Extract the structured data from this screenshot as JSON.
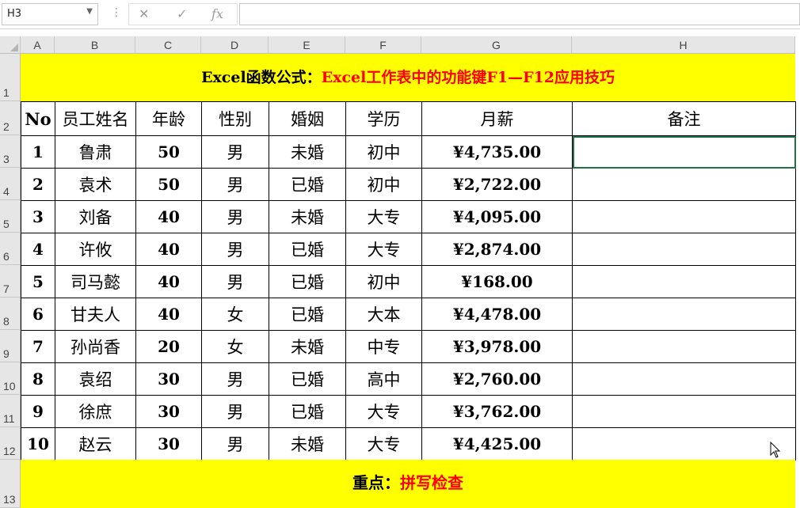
{
  "namebox": {
    "value": "H3"
  },
  "formula_bar": {
    "content": ""
  },
  "columns": [
    "A",
    "B",
    "C",
    "D",
    "E",
    "F",
    "G",
    "H"
  ],
  "rows": [
    "1",
    "2",
    "3",
    "4",
    "5",
    "6",
    "7",
    "8",
    "9",
    "10",
    "11",
    "12",
    "13"
  ],
  "title": {
    "prefix": "Excel函数公式：",
    "main": "Excel工作表中的功能键F1—F12应用技巧"
  },
  "table": {
    "headers": [
      "No",
      "员工姓名",
      "年龄",
      "性别",
      "婚姻",
      "学历",
      "月薪",
      "备注"
    ],
    "rows": [
      [
        "1",
        "鲁肃",
        "50",
        "男",
        "未婚",
        "初中",
        "¥4,735.00",
        ""
      ],
      [
        "2",
        "袁术",
        "50",
        "男",
        "已婚",
        "初中",
        "¥2,722.00",
        ""
      ],
      [
        "3",
        "刘备",
        "40",
        "男",
        "未婚",
        "大专",
        "¥4,095.00",
        ""
      ],
      [
        "4",
        "许攸",
        "40",
        "男",
        "已婚",
        "大专",
        "¥2,874.00",
        ""
      ],
      [
        "5",
        "司马懿",
        "40",
        "男",
        "已婚",
        "初中",
        "¥168.00",
        ""
      ],
      [
        "6",
        "甘夫人",
        "40",
        "女",
        "已婚",
        "大本",
        "¥4,478.00",
        ""
      ],
      [
        "7",
        "孙尚香",
        "20",
        "女",
        "未婚",
        "中专",
        "¥3,978.00",
        ""
      ],
      [
        "8",
        "袁绍",
        "30",
        "男",
        "已婚",
        "高中",
        "¥2,760.00",
        ""
      ],
      [
        "9",
        "徐庶",
        "30",
        "男",
        "已婚",
        "大专",
        "¥3,762.00",
        ""
      ],
      [
        "10",
        "赵云",
        "30",
        "男",
        "未婚",
        "大专",
        "¥4,425.00",
        ""
      ]
    ]
  },
  "footer": {
    "prefix": "重点：",
    "main": "拼写检查"
  },
  "colors": {
    "highlight": "#ffff00",
    "accent": "#ff0000"
  }
}
